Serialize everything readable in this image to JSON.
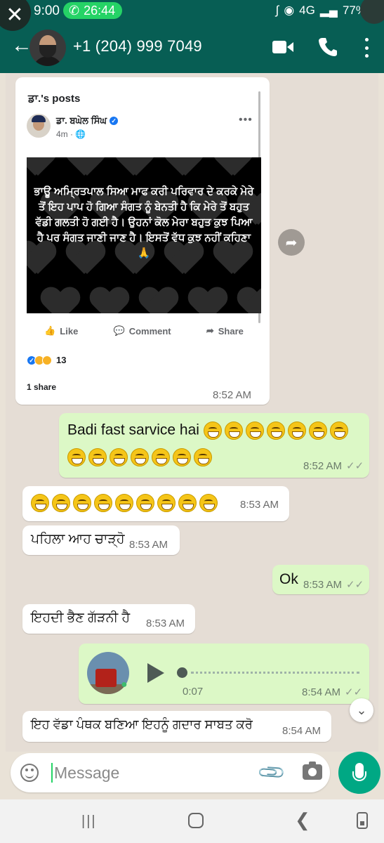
{
  "status_bar": {
    "time": "9:00",
    "call_duration": "26:44",
    "network": "4G",
    "battery": "77%"
  },
  "header": {
    "contact": "+1 (204) 999 7049"
  },
  "fb_post": {
    "page_label": "ਡਾ.'s posts",
    "author": "ਡਾ. ਬਘੇਲ ਸਿੰਘ",
    "meta": "4m · 🌐",
    "image_text": "ਭਾਊ ਅਮ੍ਰਿਤਪਾਲ ਸਿਆ ਮਾਫ ਕਰੀ ਪਰਿਵਾਰ ਦੇ ਕਰਕੇ ਮੇਰੇ ਤੋਂ ਇਹ ਪਾਪ ਹੋ ਗਿਆ ਸੰਗਤ ਨੂੰ ਬੇਨਤੀ ਹੈ ਕਿ ਮੇਰੇ ਤੋਂ ਬਹੁਤ ਵੱਡੀ ਗਲਤੀ ਹੋ ਗਈ ਹੈ। ਉਹਨਾਂ ਕੋਲ ਮੇਰਾ ਬਹੁਤ ਕੁਝ ਪਿਆ ਹੈ ਪਰ ਸੰਗਤ ਜਾਣੀ ਜਾਣ ਹੈ। ਇਸਤੋਂ ਵੱਧ ਕੁਝ ਨਹੀਂ ਕਹਿਣਾ 🙏",
    "like": "Like",
    "comment": "Comment",
    "share": "Share",
    "reaction_count": "13",
    "shares": "1 share",
    "time": "8:52 AM"
  },
  "messages": [
    {
      "text": "Badi fast sarvice hai",
      "time": "8:52 AM"
    },
    {
      "text": "",
      "time": "8:53 AM"
    },
    {
      "text": "ਪਹਿਲਾ ਆਹ ਚਾੜ੍ਹੋ",
      "time": "8:53 AM"
    },
    {
      "text": "Ok",
      "time": "8:53 AM"
    },
    {
      "text": "ਇਹਦੀ ਭੈਣ ਗੱੜਨੀ ਹੈ",
      "time": "8:53 AM"
    },
    {
      "text": "",
      "time": "8:54 AM",
      "duration": "0:07"
    },
    {
      "text": "ਇਹ ਵੱਡਾ ਪੰਥਕ ਬਣਿਆ ਇਹਨੂੰ ਗਦਾਰ ਸਾਬਤ ਕਰੋ",
      "time": "8:54 AM"
    }
  ],
  "input": {
    "placeholder": "Message"
  },
  "colors": {
    "header": "#075e54",
    "outgoing": "#dcf8c6",
    "incoming": "#ffffff",
    "accent": "#00a884"
  }
}
